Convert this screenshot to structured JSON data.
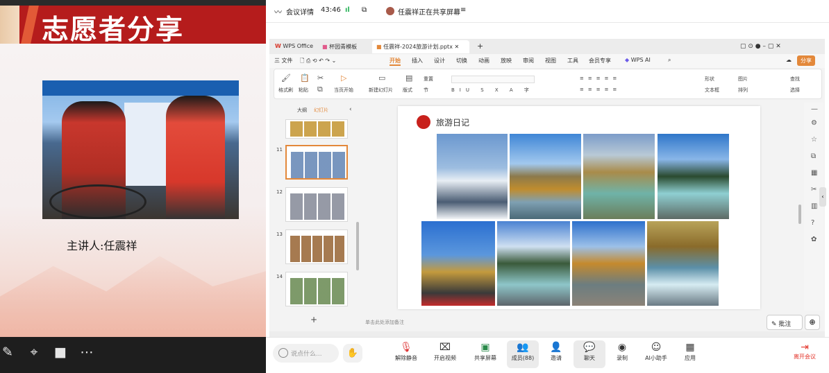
{
  "left": {
    "title": "志愿者分享",
    "speaker": "主讲人:任震祥"
  },
  "meeting": {
    "details_label": "会议详情",
    "timer": "43:46",
    "sharing_status": "任震祥正在共享屏幕"
  },
  "wps": {
    "tabs": [
      "WPS Office",
      "杯园青模板",
      "任震祥-2024旅游计划.pptx"
    ],
    "menu": [
      "三 文件",
      "开始",
      "插入",
      "设计",
      "切换",
      "动画",
      "放映",
      "审阅",
      "视图",
      "工具",
      "会员专享",
      "WPS AI"
    ],
    "share_button": "分享",
    "ribbon": {
      "format_painter": "格式刷",
      "paste": "粘贴",
      "play_from_current": "当页开始",
      "new_slide": "新建幻灯片",
      "layout": "版式",
      "section": "节",
      "reset": "重置",
      "shape": "形状",
      "picture": "图片",
      "text_box": "文本框",
      "arrange": "排列",
      "find": "查找",
      "select": "选择"
    },
    "pane_tabs": [
      "大纲",
      "幻灯片"
    ],
    "slide_numbers": [
      "11",
      "12",
      "13",
      "14"
    ],
    "slide_title": "旅游日记",
    "notes_placeholder": "单击此处添加备注",
    "annotate_button": "批注"
  },
  "bottom_bar": {
    "chat_placeholder": "说点什么...",
    "buttons": [
      {
        "label": "解除静音",
        "icon": "mic-muted-icon"
      },
      {
        "label": "开启视频",
        "icon": "video-off-icon"
      },
      {
        "label": "共享屏幕",
        "icon": "screen-share-icon"
      },
      {
        "label": "成员(88)",
        "icon": "members-icon"
      },
      {
        "label": "邀请",
        "icon": "invite-icon"
      },
      {
        "label": "聊天",
        "icon": "chat-icon"
      },
      {
        "label": "录制",
        "icon": "record-icon"
      },
      {
        "label": "AI小助手",
        "icon": "ai-assistant-icon"
      },
      {
        "label": "应用",
        "icon": "apps-icon"
      }
    ],
    "leave": "离开会议"
  },
  "colors": {
    "title_red": "#b51c1c",
    "accent_orange": "#e3883a",
    "leave_red": "#e3342a"
  }
}
